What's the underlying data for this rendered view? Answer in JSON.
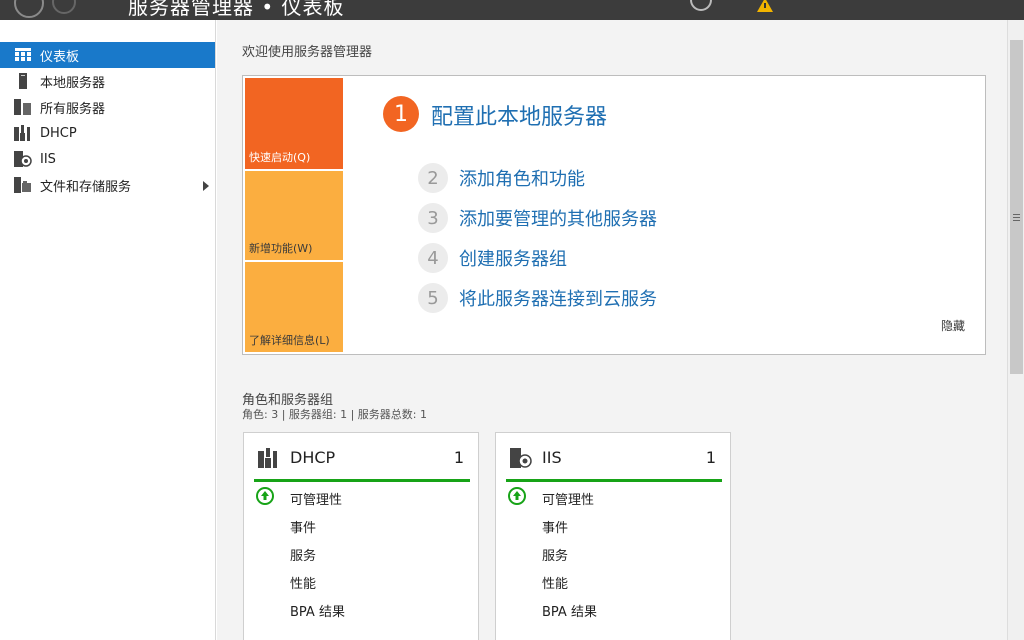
{
  "titlebar": {
    "title": "服务器管理器 • 仪表板",
    "icons": [
      "back-icon",
      "forward-icon",
      "refresh-icon",
      "warning-flag-icon"
    ]
  },
  "sidebar": {
    "items": [
      {
        "label": "仪表板",
        "icon": "dashboard-icon",
        "active": true
      },
      {
        "label": "本地服务器",
        "icon": "local-server-icon"
      },
      {
        "label": "所有服务器",
        "icon": "all-servers-icon"
      },
      {
        "label": "DHCP",
        "icon": "dhcp-icon"
      },
      {
        "label": "IIS",
        "icon": "iis-icon"
      },
      {
        "label": "文件和存储服务",
        "icon": "file-storage-icon",
        "has_submenu": true
      }
    ]
  },
  "welcome": {
    "title": "欢迎使用服务器管理器",
    "tiles": {
      "quick_start": "快速启动(Q)",
      "whats_new": "新增功能(W)",
      "learn_more": "了解详细信息(L)"
    },
    "steps": [
      {
        "num": "1",
        "label": "配置此本地服务器"
      },
      {
        "num": "2",
        "label": "添加角色和功能"
      },
      {
        "num": "3",
        "label": "添加要管理的其他服务器"
      },
      {
        "num": "4",
        "label": "创建服务器组"
      },
      {
        "num": "5",
        "label": "将此服务器连接到云服务"
      }
    ],
    "hide_label": "隐藏"
  },
  "roles": {
    "title": "角色和服务器组",
    "summary": "角色: 3 | 服务器组: 1 | 服务器总数: 1",
    "cards": [
      {
        "name": "DHCP",
        "count": "1",
        "rows": [
          "可管理性",
          "事件",
          "服务",
          "性能",
          "BPA 结果"
        ]
      },
      {
        "name": "IIS",
        "count": "1",
        "rows": [
          "可管理性",
          "事件",
          "服务",
          "性能",
          "BPA 结果"
        ]
      }
    ]
  },
  "colors": {
    "accent": "#1979ca",
    "quick_start_tile": "#f26522",
    "secondary_tile": "#fbae40",
    "link": "#1f6fb2",
    "status_ok": "#17a317"
  }
}
